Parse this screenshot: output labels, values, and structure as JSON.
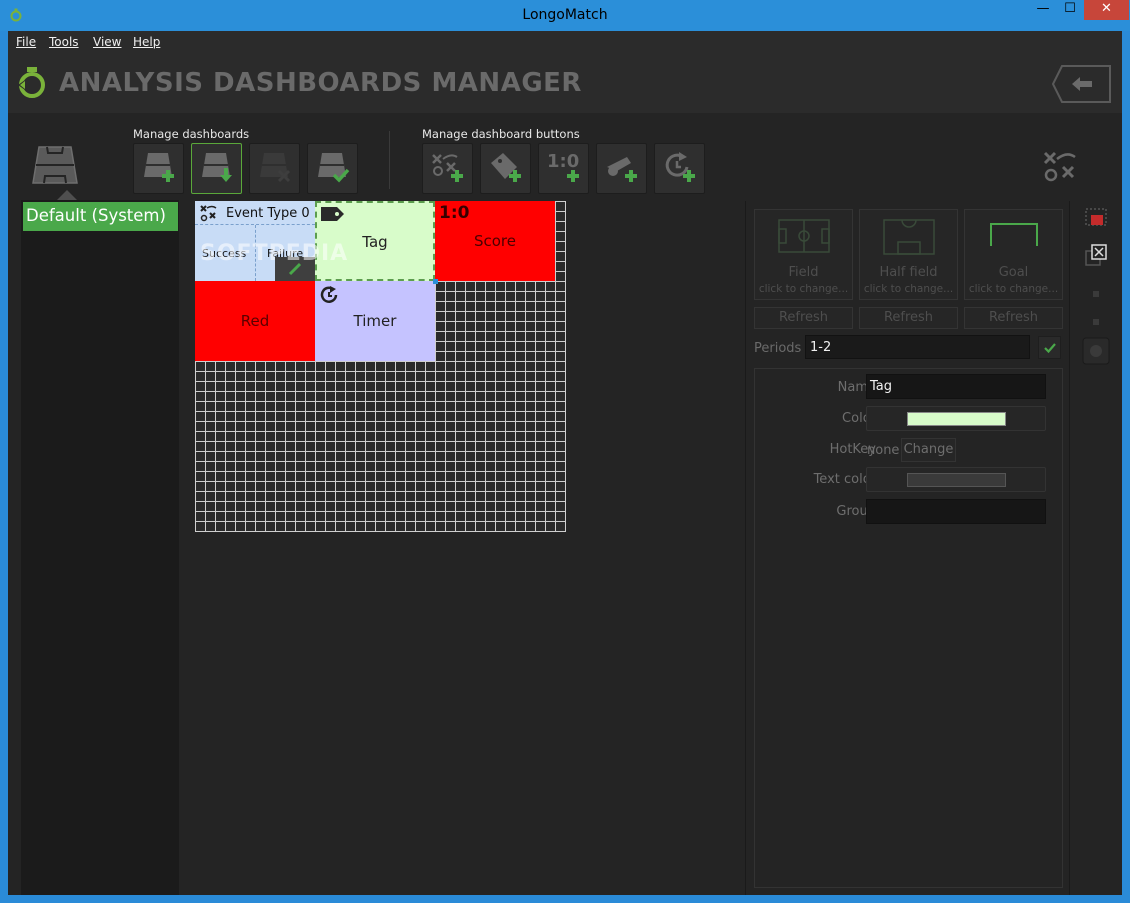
{
  "window": {
    "title": "LongoMatch",
    "minimize_glyph": "—",
    "maximize_glyph": "☐",
    "close_glyph": "✕"
  },
  "menu": {
    "items": [
      "File",
      "Tools",
      "View",
      "Help"
    ]
  },
  "header": {
    "title": "ANALYSIS DASHBOARDS MANAGER",
    "back_glyph": "⇐"
  },
  "toolbar": {
    "manage_dashboards_label": "Manage dashboards",
    "manage_buttons_label": "Manage dashboard buttons",
    "score_icon_text": "1:0"
  },
  "dashboards": {
    "items": [
      "Default (System)"
    ]
  },
  "canvas": {
    "watermark": "SOFTPEDIA",
    "event_tile": {
      "title": "Event Type 0",
      "success": "Success",
      "failure": "Failure",
      "color": "#c8dcf6"
    },
    "tag_tile": {
      "label": "Tag",
      "color": "#d8fcca"
    },
    "score_tile": {
      "label": "Score",
      "badge": "1:0",
      "color": "#ff0000"
    },
    "red_tile": {
      "label": "Red",
      "color": "#ff0000"
    },
    "timer_tile": {
      "label": "Timer",
      "color": "#c5c3ff"
    }
  },
  "backgrounds": {
    "field": {
      "name": "Field",
      "hint": "click to change..."
    },
    "half_field": {
      "name": "Half field",
      "hint": "click to change..."
    },
    "goal": {
      "name": "Goal",
      "hint": "click to change..."
    },
    "refresh_label": "Refresh"
  },
  "periods": {
    "label": "Periods",
    "value": "1-2"
  },
  "properties": {
    "name_label": "Name",
    "name_value": "Tag",
    "color_label": "Color",
    "color_value": "#d8fcca",
    "hotkey_label": "HotKey",
    "hotkey_value": "none",
    "change_label": "Change",
    "text_color_label": "Text color",
    "text_color_value": "#3a3a3a",
    "group_label": "Group",
    "group_value": ""
  },
  "colors": {
    "accent": "#4aa84a",
    "titlebar": "#2b8fd9",
    "background": "#242424"
  }
}
